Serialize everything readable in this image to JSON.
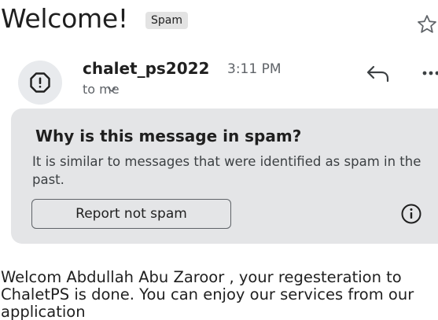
{
  "subject": {
    "title": "Welcome!",
    "label_chip": "Spam"
  },
  "sender": {
    "name": "chalet_ps2022",
    "time": "3:11 PM",
    "recipient": "to me"
  },
  "spam_warning": {
    "title": "Why is this message in spam?",
    "body": "It is similar to messages that were identified as spam in the past.",
    "button_label": "Report not spam"
  },
  "message": {
    "body": "Welcom Abdullah Abu Zaroor , your regesteration to ChaletPS is done. You can enjoy our services from our application"
  },
  "icons": {
    "star": "star-outline-icon",
    "avatar": "alert-circle-icon",
    "chevron": "chevron-down-icon",
    "reply": "reply-icon",
    "more": "more-horizontal-icon",
    "info": "info-icon"
  },
  "colors": {
    "card_background": "#e4e5e7",
    "chip_background": "#e3e3e3",
    "secondary_text": "#5f6368"
  }
}
